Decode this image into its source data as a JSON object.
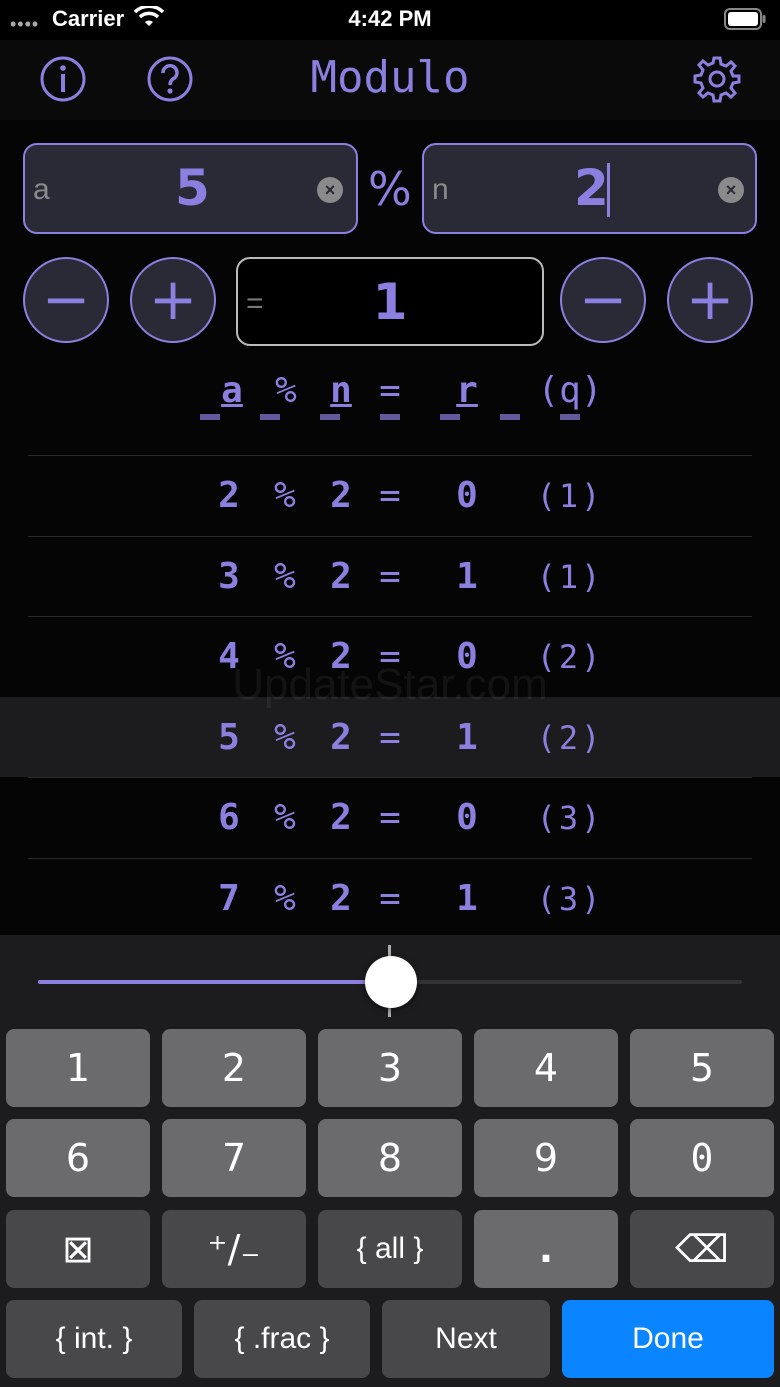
{
  "status": {
    "carrier": "Carrier",
    "time": "4:42 PM"
  },
  "nav": {
    "title": "Modulo"
  },
  "inputs": {
    "a": {
      "placeholder": "a",
      "value": "5"
    },
    "operator": "%",
    "n": {
      "placeholder": "n",
      "value": "2"
    },
    "result": {
      "placeholder": "=",
      "value": "1"
    }
  },
  "table": {
    "header": [
      "a",
      "%",
      "n",
      "=",
      "r",
      "(q)"
    ],
    "rows": [
      [
        "2",
        "%",
        "2",
        "=",
        "0",
        "(1)"
      ],
      [
        "3",
        "%",
        "2",
        "=",
        "1",
        "(1)"
      ],
      [
        "4",
        "%",
        "2",
        "=",
        "0",
        "(2)"
      ],
      [
        "5",
        "%",
        "2",
        "=",
        "1",
        "(2)"
      ],
      [
        "6",
        "%",
        "2",
        "=",
        "0",
        "(3)"
      ],
      [
        "7",
        "%",
        "2",
        "=",
        "1",
        "(3)"
      ]
    ],
    "highlighted_row": 3
  },
  "slider": {
    "value": 0.5
  },
  "keypad": {
    "row1": [
      "1",
      "2",
      "3",
      "4",
      "5"
    ],
    "row2": [
      "6",
      "7",
      "8",
      "9",
      "0"
    ],
    "row3": [
      "⊠",
      "⁺/₋",
      "{ all }",
      ".",
      "⌫"
    ],
    "row4": [
      "{ int. }",
      "{ .frac }",
      "Next",
      "Done"
    ]
  },
  "colors": {
    "accent": "#8b7fe0",
    "done": "#0a84ff"
  }
}
